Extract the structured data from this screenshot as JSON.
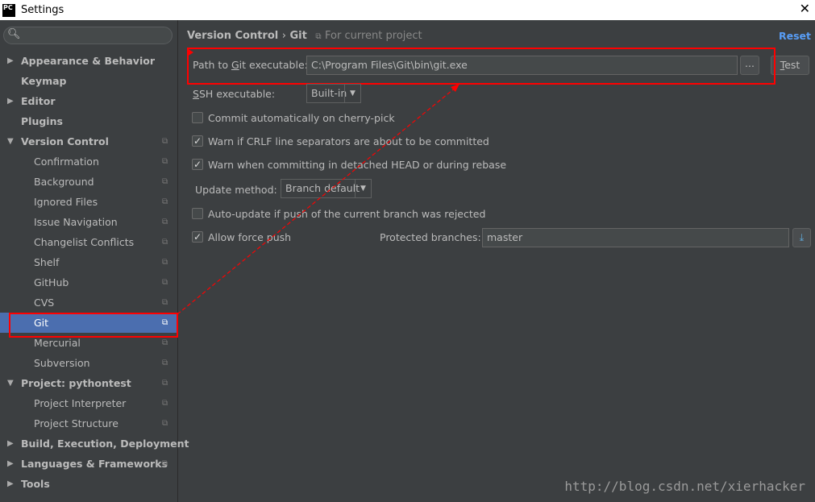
{
  "window": {
    "title": "Settings",
    "logo": "PC",
    "close_icon": "close-icon"
  },
  "sidebar": {
    "items": [
      {
        "label": "Appearance & Behavior",
        "level": "top",
        "arrow": "collapsed"
      },
      {
        "label": "Keymap",
        "level": "top"
      },
      {
        "label": "Editor",
        "level": "top",
        "arrow": "collapsed"
      },
      {
        "label": "Plugins",
        "level": "top"
      },
      {
        "label": "Version Control",
        "level": "top",
        "arrow": "expanded",
        "project": true
      },
      {
        "label": "Confirmation",
        "level": "sub",
        "project": true
      },
      {
        "label": "Background",
        "level": "sub",
        "project": true
      },
      {
        "label": "Ignored Files",
        "level": "sub",
        "project": true
      },
      {
        "label": "Issue Navigation",
        "level": "sub",
        "project": true
      },
      {
        "label": "Changelist Conflicts",
        "level": "sub",
        "project": true
      },
      {
        "label": "Shelf",
        "level": "sub",
        "project": true
      },
      {
        "label": "GitHub",
        "level": "sub",
        "project": true
      },
      {
        "label": "CVS",
        "level": "sub",
        "project": true
      },
      {
        "label": "Git",
        "level": "sub",
        "project": true,
        "selected": true
      },
      {
        "label": "Mercurial",
        "level": "sub",
        "project": true
      },
      {
        "label": "Subversion",
        "level": "sub",
        "project": true
      },
      {
        "label": "Project: pythontest",
        "level": "top",
        "arrow": "expanded",
        "project": true
      },
      {
        "label": "Project Interpreter",
        "level": "sub",
        "project": true
      },
      {
        "label": "Project Structure",
        "level": "sub",
        "project": true
      },
      {
        "label": "Build, Execution, Deployment",
        "level": "top",
        "arrow": "collapsed"
      },
      {
        "label": "Languages & Frameworks",
        "level": "top",
        "arrow": "collapsed",
        "project": true
      },
      {
        "label": "Tools",
        "level": "top",
        "arrow": "collapsed"
      }
    ]
  },
  "header": {
    "crumb1": "Version Control",
    "sep": "›",
    "crumb2": "Git",
    "scope": "For current project",
    "reset": "Reset"
  },
  "git": {
    "path_label": "Path to Git executable:",
    "path_value": "C:\\Program Files\\Git\\bin\\git.exe",
    "browse": "...",
    "test": "Test",
    "ssh_label": "SSH executable:",
    "ssh_value": "Built-in",
    "cherry_pick": {
      "label": "Commit automatically on cherry-pick",
      "checked": false
    },
    "crlf": {
      "label": "Warn if CRLF line separators are about to be committed",
      "checked": true
    },
    "detached": {
      "label": "Warn when committing in detached HEAD or during rebase",
      "checked": true
    },
    "update_label": "Update method:",
    "update_value": "Branch default",
    "auto_update": {
      "label": "Auto-update if push of the current branch was rejected",
      "checked": false
    },
    "force_push": {
      "label": "Allow force push",
      "checked": true
    },
    "protected_label": "Protected branches:",
    "protected_value": "master"
  },
  "annotation_color": "#ff0000",
  "watermark": "http://blog.csdn.net/xierhacker"
}
